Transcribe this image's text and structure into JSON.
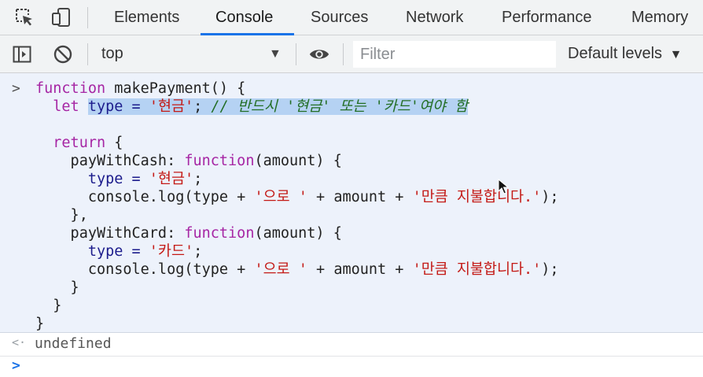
{
  "tabs": [
    {
      "label": "Elements",
      "active": false
    },
    {
      "label": "Console",
      "active": true
    },
    {
      "label": "Sources",
      "active": false
    },
    {
      "label": "Network",
      "active": false
    },
    {
      "label": "Performance",
      "active": false
    },
    {
      "label": "Memory",
      "active": false
    }
  ],
  "toolbar": {
    "context": "top",
    "filter_placeholder": "Filter",
    "levels": "Default levels"
  },
  "icons": {
    "inspect": "inspect-element-icon",
    "device": "device-toolbar-icon",
    "sidebar": "show-sidebar-icon",
    "clear": "clear-console-icon",
    "eye": "live-expression-icon",
    "dropdown": "dropdown-arrow-icon",
    "prompt": "chevron-right-icon",
    "result": "result-arrow-icon"
  },
  "colors": {
    "accent": "#1a73e8",
    "keyword": "#a626a4",
    "string": "#c41a16",
    "comment": "#236e25",
    "selection": "#b5d2f3"
  },
  "console": {
    "prompt_glyph": ">",
    "result_glyph": "<·",
    "code": {
      "l1_kw": "function",
      "l1_rest": " makePayment() {",
      "l2_indent": "  ",
      "l2_kw": "let",
      "l2_sp": " ",
      "l2_sel_a": "type = ",
      "l2_sel_str": "'현금'",
      "l2_sel_b": "; ",
      "l2_sel_cm": "// 반드시 '현금' 또는 '카드'여야 함",
      "l4_indent": "  ",
      "l4_kw": "return",
      "l4_rest": " {",
      "l5_a": "    payWithCash: ",
      "l5_kw": "function",
      "l5_b": "(amount) {",
      "l6_a": "      type = ",
      "l6_str": "'현금'",
      "l6_b": ";",
      "l7_a": "      console.log(type + ",
      "l7_str1": "'으로 '",
      "l7_b": " + amount + ",
      "l7_str2": "'만큼 지불합니다.'",
      "l7_c": ");",
      "l8": "    },",
      "l9_a": "    payWithCard: ",
      "l9_kw": "function",
      "l9_b": "(amount) {",
      "l10_a": "      type = ",
      "l10_str": "'카드'",
      "l10_b": ";",
      "l11_a": "      console.log(type + ",
      "l11_str1": "'으로 '",
      "l11_b": " + amount + ",
      "l11_str2": "'만큼 지불합니다.'",
      "l11_c": ");",
      "l12": "    }",
      "l13": "  }",
      "l14": "}"
    },
    "result": "undefined",
    "input_glyph": ">"
  }
}
